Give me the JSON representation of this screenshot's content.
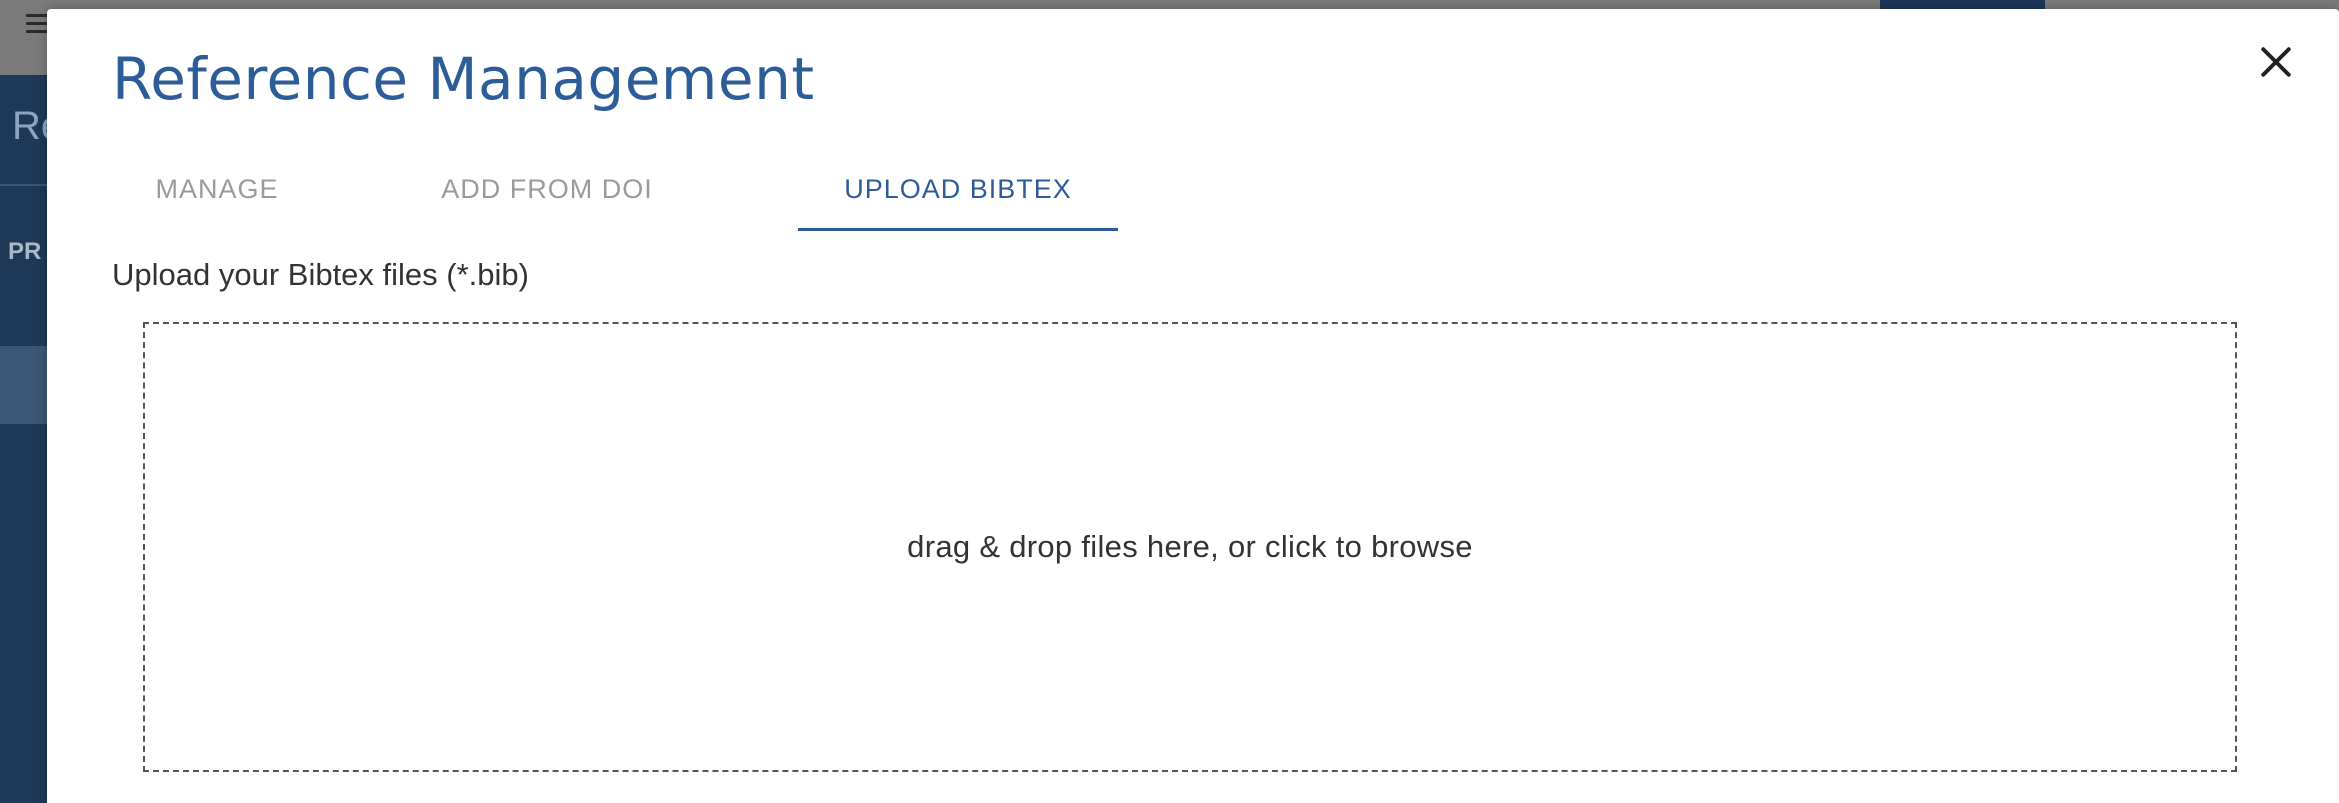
{
  "modal": {
    "title": "Reference Management",
    "tabs": [
      {
        "label": "MANAGE",
        "active": false
      },
      {
        "label": "ADD FROM DOI",
        "active": false
      },
      {
        "label": "UPLOAD BIBTEX",
        "active": true
      }
    ],
    "upload_label": "Upload your Bibtex files (*.bib)",
    "dropzone_text": "drag & drop files here, or click to browse",
    "close_icon": "close-icon"
  },
  "background": {
    "sidebar_title_fragment": "Re",
    "sidebar_section_fragment": "PR"
  },
  "colors": {
    "accent": "#2d5d99",
    "sidebar": "#1e3858",
    "tab_inactive": "#9a9a9a",
    "text": "#333333"
  }
}
